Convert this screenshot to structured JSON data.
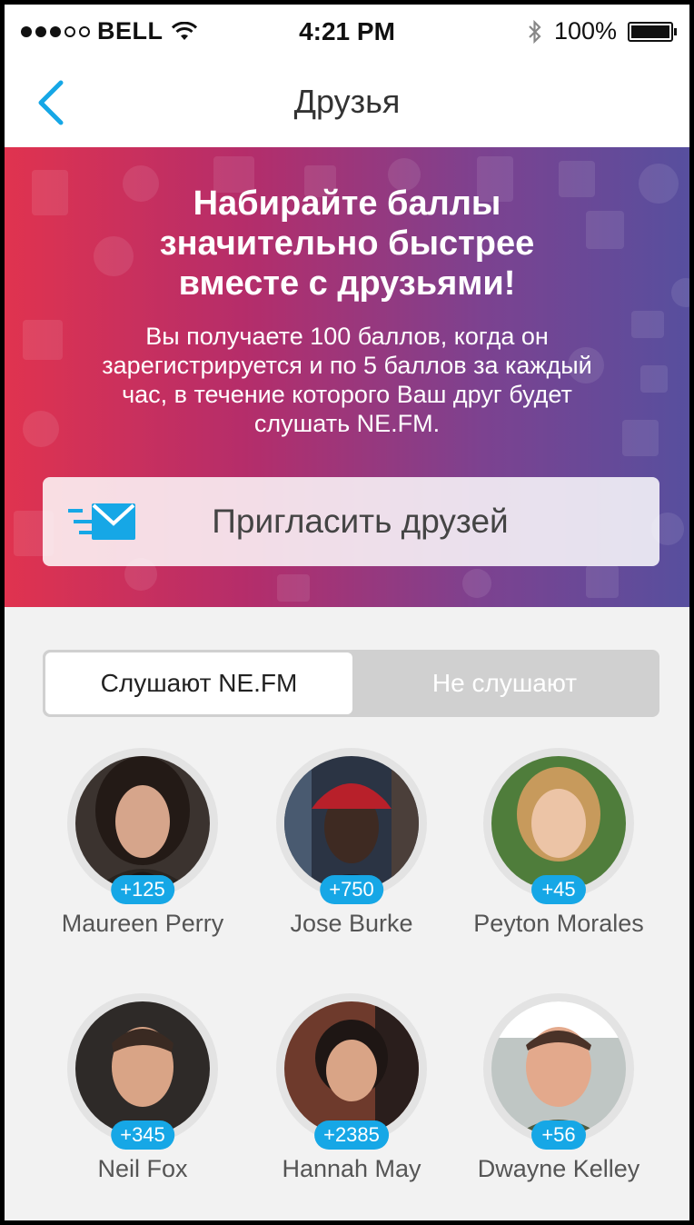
{
  "status_bar": {
    "carrier": "BELL",
    "time": "4:21 PM",
    "battery": "100%",
    "signal_filled": 3,
    "signal_total": 5
  },
  "nav": {
    "title": "Друзья",
    "back_icon": "chevron-left-icon"
  },
  "banner": {
    "title_lines": [
      "Набирайте баллы",
      "значительно быстрее",
      "вместе с друзьями!"
    ],
    "text_lines": [
      "Вы получаете 100 баллов, когда он",
      "зарегистрируется и по 5 баллов за каждый",
      "час, в течение которого Ваш друг будет",
      "слушать NE.FM."
    ],
    "invite_label": "Пригласить друзей",
    "invite_icon": "send-mail-icon"
  },
  "tabs": [
    {
      "label": "Слушают NE.FM",
      "active": true
    },
    {
      "label": "Не слушают",
      "active": false
    }
  ],
  "friends": [
    {
      "name": "Maureen Perry",
      "points": "+125"
    },
    {
      "name": "Jose Burke",
      "points": "+750"
    },
    {
      "name": "Peyton Morales",
      "points": "+45"
    },
    {
      "name": "Neil Fox",
      "points": "+345"
    },
    {
      "name": "Hannah May",
      "points": "+2385"
    },
    {
      "name": "Dwayne Kelley",
      "points": "+56"
    }
  ],
  "colors": {
    "accent": "#16a7e6",
    "banner_start": "#e0334f",
    "banner_end": "#574f9e"
  }
}
